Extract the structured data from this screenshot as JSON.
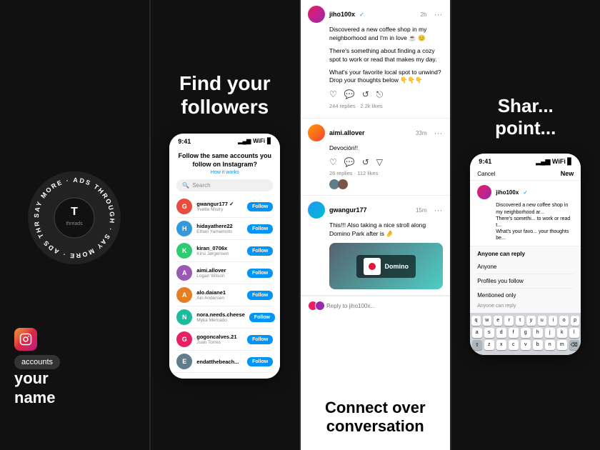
{
  "panel1": {
    "circular_text": "SAY MORE · ADS THROUGH · SAY MORE · ADS THROUGH ·",
    "bottom_text_line1": "your",
    "bottom_text_line2": "name",
    "accounts_label": "accounts"
  },
  "panel2": {
    "title_line1": "Find your",
    "title_line2": "followers",
    "phone": {
      "status_time": "9:41",
      "signal": "▂▄▆",
      "wifi": "WiFi",
      "battery": "■",
      "heading": "Follow the same accounts you follow on Instagram?",
      "subheading": "How it works",
      "search_placeholder": "Search",
      "users": [
        {
          "username": "gwangur177 ✓",
          "realname": "Yvette Mistry",
          "color": "#e74c3c"
        },
        {
          "username": "hidayathere22",
          "realname": "Ethan Yamamoto",
          "color": "#3498db"
        },
        {
          "username": "kiran_0706x",
          "realname": "Kirsi Jørgensen",
          "color": "#2ecc71"
        },
        {
          "username": "aimi.allover",
          "realname": "Logan Wilson",
          "color": "#9b59b6"
        },
        {
          "username": "alo.daiane1",
          "realname": "Ain Andersen",
          "color": "#e67e22"
        },
        {
          "username": "nora.needs.cheese",
          "realname": "Myka Mercado",
          "color": "#1abc9c"
        },
        {
          "username": "gogoncalves.21",
          "realname": "Juan Torres",
          "color": "#e91e63"
        },
        {
          "username": "endatthebeach...",
          "realname": "",
          "color": "#607d8b"
        }
      ],
      "follow_label": "Follow"
    }
  },
  "panel3": {
    "posts": [
      {
        "username": "jiho100x",
        "time": "2h",
        "text": "Discovered a new coffee shop in my neighborhood and I'm in love ☕ 😊",
        "text2": "There's something about finding a cozy spot to work or read that makes my day.",
        "text3": "What's your favorite local spot to unwind? Drop your thoughts below 👇👇👇",
        "replies": "244 replies",
        "likes": "2.2k likes"
      },
      {
        "username": "aimi.allover",
        "time": "33m",
        "text": "Devoción!!",
        "replies": "26 replies",
        "likes": "112 likes"
      },
      {
        "username": "gwangur177",
        "time": "15m",
        "text": "This!!! Also taking a nice stroll along Domino Park after is 🤌",
        "has_image": true
      }
    ],
    "reply_placeholder": "Reply to jiho100x...",
    "bottom_label": "Connect over conversation"
  },
  "panel4": {
    "title_line1": "Shar",
    "title_line2": "point",
    "phone": {
      "status_time": "9:41",
      "cancel_label": "Cancel",
      "new_label": "New",
      "user": {
        "username": "jiho100x",
        "text1": "Discovered a new coffee shop in my neighborhood ar...",
        "text2": "There's somethi... to work or read t...",
        "text3": "What's your favo... your thoughts be..."
      },
      "reply_label": "Anyone can reply",
      "options": [
        "Anyone",
        "Profiles you follow",
        "Mentioned only"
      ],
      "selected_option": "Anyone can reply",
      "keyboard": {
        "row1": [
          "q",
          "w",
          "e",
          "r",
          "t",
          "y",
          "u",
          "i",
          "o",
          "p"
        ],
        "row2": [
          "a",
          "s",
          "d",
          "f",
          "g",
          "h",
          "j",
          "k",
          "l"
        ],
        "row3": [
          "⇧",
          "z",
          "x",
          "c",
          "v",
          "b",
          "n",
          "m",
          "⌫"
        ]
      }
    }
  }
}
